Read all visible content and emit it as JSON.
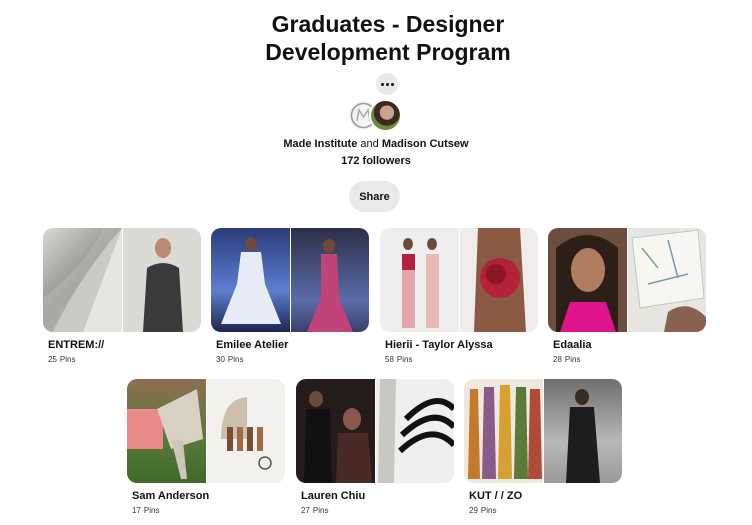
{
  "board": {
    "title": "Graduates - Designer Development Program",
    "title_line1": "Graduates - Designer",
    "title_line2": "Development Program",
    "more_icon": "ellipsis-icon",
    "collaborators": [
      "Made Institute",
      "Madison Cutsew"
    ],
    "collab_joiner": "and",
    "followers": "172 followers",
    "share_label": "Share"
  },
  "sections": [
    {
      "name": "ENTREM://",
      "pins": "25",
      "unit": "Pins"
    },
    {
      "name": "Emilee Atelier",
      "pins": "30",
      "unit": "Pins"
    },
    {
      "name": "Hierii - Taylor Alyssa",
      "pins": "58",
      "unit": "Pins"
    },
    {
      "name": "Edaalia",
      "pins": "28",
      "unit": "Pins"
    },
    {
      "name": "Sam Anderson",
      "pins": "17",
      "unit": "Pins"
    },
    {
      "name": "Lauren Chiu",
      "pins": "27",
      "unit": "Pins"
    },
    {
      "name": "KUT / / ZO",
      "pins": "29",
      "unit": "Pins"
    }
  ],
  "colors": {
    "button_bg": "#e9e9e9",
    "text": "#111111"
  }
}
